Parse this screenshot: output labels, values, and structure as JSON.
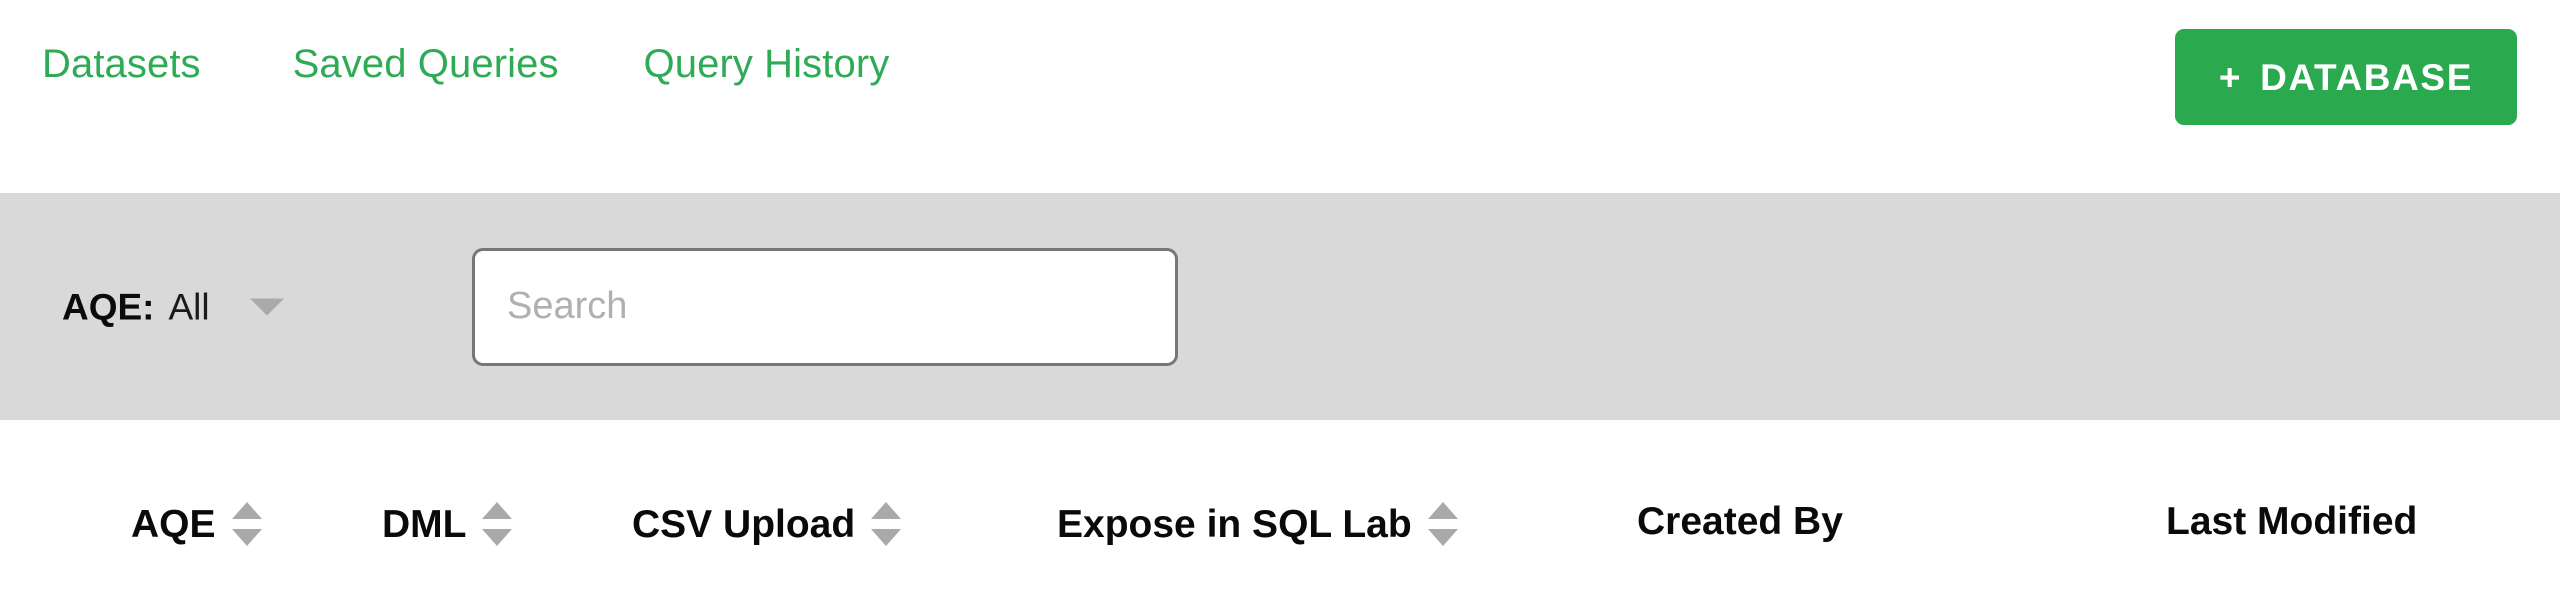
{
  "topbar": {
    "tabs": [
      {
        "label": "Datasets"
      },
      {
        "label": "Saved Queries"
      },
      {
        "label": "Query History"
      }
    ],
    "primary_button": {
      "plus": "+",
      "label": "DATABASE",
      "color": "#2ba94f",
      "text_color": "#ffffff"
    },
    "tab_color": "#2eab55"
  },
  "filterbar": {
    "background": "#d9d9d9",
    "filter": {
      "label": "AQE:",
      "value": "All",
      "caret_icon": "chevron-down-icon"
    },
    "search": {
      "value": "",
      "placeholder": "Search"
    }
  },
  "table": {
    "columns": [
      {
        "label": "AQE",
        "sortable": true
      },
      {
        "label": "DML",
        "sortable": true
      },
      {
        "label": "CSV Upload",
        "sortable": true
      },
      {
        "label": "Expose in SQL Lab",
        "sortable": true
      },
      {
        "label": "Created By",
        "sortable": false
      },
      {
        "label": "Last Modified",
        "sortable": false
      }
    ],
    "sort_icon": "sort-arrows-icon",
    "header_text_color": "#0a0a0a",
    "sort_icon_color": "#a9a9a9"
  }
}
